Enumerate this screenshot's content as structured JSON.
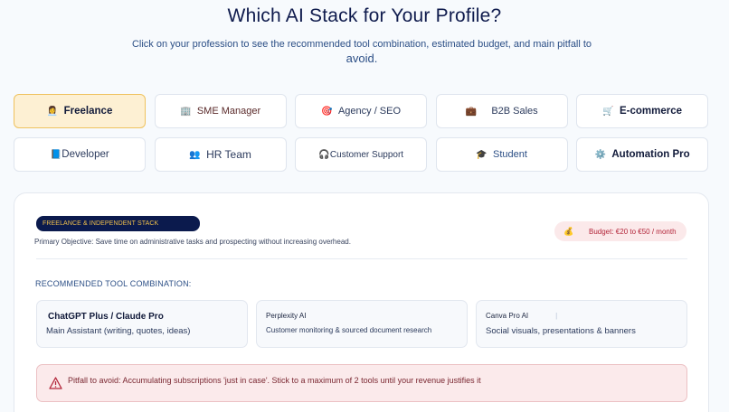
{
  "header": {
    "title": "Which AI Stack for Your Profile?",
    "subtitle": "Click on your profession to see the recommended tool combination, estimated budget, and main pitfall to",
    "subtitle_tail": "avoid."
  },
  "tabs": [
    {
      "id": "freelance",
      "icon": "👩‍💼",
      "icon_name": "freelancer-icon",
      "label": "Freelance",
      "active": true
    },
    {
      "id": "sme",
      "icon": "🏢",
      "icon_name": "office-building-icon",
      "label": "SME Manager",
      "active": false
    },
    {
      "id": "agency",
      "icon": "🎯",
      "icon_name": "target-icon",
      "label": "Agency / SEO",
      "active": false
    },
    {
      "id": "b2b",
      "icon": "💼",
      "icon_name": "briefcase-icon",
      "label": "B2B Sales",
      "active": false
    },
    {
      "id": "ecommerce",
      "icon": "🛒",
      "icon_name": "shopping-cart-icon",
      "label": "E-commerce",
      "active": false
    },
    {
      "id": "developer",
      "icon": "📘",
      "icon_name": "book-icon",
      "label": "Developer",
      "active": false
    },
    {
      "id": "hr",
      "icon": "👥",
      "icon_name": "people-icon",
      "label": "HR Team",
      "active": false
    },
    {
      "id": "support",
      "icon": "🎧",
      "icon_name": "headphones-icon",
      "label": "Customer Support",
      "active": false
    },
    {
      "id": "student",
      "icon": "🎓",
      "icon_name": "graduation-cap-icon",
      "label": "Student",
      "active": false
    },
    {
      "id": "automation",
      "icon": "⚙️",
      "icon_name": "gear-icon",
      "label": "Automation Pro",
      "active": false
    }
  ],
  "panel": {
    "stack_badge": "FREELANCE & INDEPENDENT STACK",
    "objective": "Primary Objective: Save time on administrative tasks and prospecting without increasing overhead.",
    "budget_icon": "💰",
    "budget": "Budget: €20 to €50 / month",
    "recommended_label": "RECOMMENDED TOOL COMBINATION:",
    "tools": [
      {
        "name": "ChatGPT Plus / Claude Pro",
        "desc": "Main Assistant (writing, quotes, ideas)"
      },
      {
        "name": "Perplexity AI",
        "desc": "Customer monitoring & sourced document research"
      },
      {
        "name": "Canva Pro AI",
        "separator": "|",
        "desc": "Social visuals, presentations & banners"
      }
    ],
    "pitfall": "Pitfall to avoid: Accumulating subscriptions 'just in case'. Stick to a maximum of 2 tools until your revenue justifies it"
  },
  "colors": {
    "accent_navy": "#0b1a4d",
    "active_tab_bg": "#fdf0d3",
    "active_tab_border": "#efc25e",
    "budget_red": "#b3263a",
    "pitfall_bg": "#fbeaeb"
  }
}
